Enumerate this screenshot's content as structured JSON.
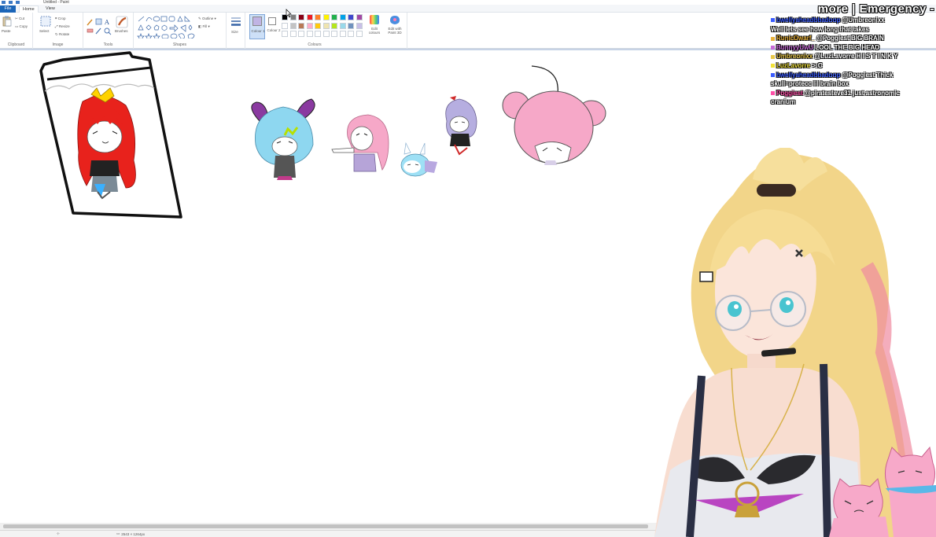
{
  "titlebar": {
    "title": "Untitled - Paint"
  },
  "menu": {
    "file": "File",
    "home": "Home",
    "view": "View"
  },
  "ribbon": {
    "clipboard": {
      "label": "Clipboard",
      "paste": "Paste",
      "cut": "Cut",
      "copy": "Copy"
    },
    "image": {
      "label": "Image",
      "select": "Select",
      "crop": "Crop",
      "resize": "Resize",
      "rotate": "Rotate"
    },
    "tools": {
      "label": "Tools",
      "brushes": "Brushes"
    },
    "shapes": {
      "label": "Shapes",
      "outline": "Outline",
      "fill": "Fill"
    },
    "size": {
      "label": "Size"
    },
    "colours": {
      "label": "Colours",
      "colour1": "Colour 1",
      "colour2": "Colour 2",
      "edit_colours": "Edit colours",
      "edit_paint3d": "Edit with Paint 3D",
      "colour1_value": "#c0b4e4",
      "colour2_value": "#ffffff",
      "palette_row1": [
        "#000000",
        "#7f7f7f",
        "#880015",
        "#ed1c24",
        "#ff7f27",
        "#fff200",
        "#22b14c",
        "#00a2e8",
        "#3f48cc",
        "#a349a4"
      ],
      "palette_row2": [
        "#ffffff",
        "#c3c3c3",
        "#b97a57",
        "#ffaec9",
        "#ffc90e",
        "#efe4b0",
        "#b5e61d",
        "#99d9ea",
        "#7092be",
        "#c8bfe7"
      ],
      "palette_row3": [
        "#ffffff",
        "#ffffff",
        "#ffffff",
        "#ffffff",
        "#ffffff",
        "#ffffff",
        "#ffffff",
        "#ffffff",
        "#ffffff",
        "#ffffff"
      ]
    }
  },
  "status": {
    "dimensions": "2543 × 1264px"
  },
  "overlay": {
    "title": "more | Emergency -"
  },
  "chat": [
    {
      "user": "bwellyaheadbbadoop",
      "user_color": "#3a5cff",
      "message": "@Umbreonixx"
    },
    {
      "user": "",
      "user_color": "#ffffff",
      "message": "Well lets see how long that takes"
    },
    {
      "user": "RunicDwarf_",
      "user_color": "#e8b13a",
      "message": "@Poggiest BIG BRAIN"
    },
    {
      "user": "BunnyyUwU",
      "user_color": "#c86bd8",
      "message": "LOOL THE BIG HEAD"
    },
    {
      "user": "Umbreonixx",
      "user_color": "#e8c84a",
      "message": "@LuzLavorre H I S T I N K Y"
    },
    {
      "user": "LuzLavorre",
      "user_color": "#f2e23a",
      "message": ">:C"
    },
    {
      "user": "bwellyaheadbbadoop",
      "user_color": "#3a5cff",
      "message": "@Poggiest Thick"
    },
    {
      "user": "",
      "user_color": "#ffffff",
      "message": "skull=protecc lil brain box"
    },
    {
      "user": "Poggiest",
      "user_color": "#ff4fa8",
      "message": "@piratesteve31 just astronomic"
    },
    {
      "user": "",
      "user_color": "#ffffff",
      "message": "cranium"
    }
  ]
}
